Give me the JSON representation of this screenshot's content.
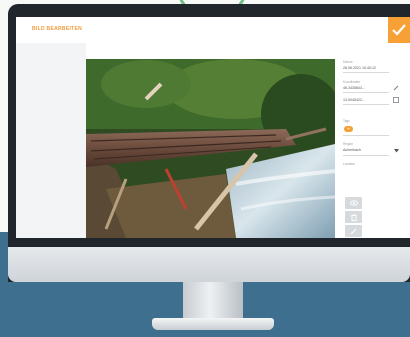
{
  "header": {
    "title": "BILD BEARBEITEN"
  },
  "sidebar": {
    "datum_label": "Datum",
    "datum_value": "28.06.2021 10:40:12",
    "koordinaten_label": "Koordinaten",
    "lat_value": "46.3435843...",
    "lon_value": "13.0045422...",
    "tags_label": "Tags",
    "tag_badge": "+",
    "region_label": "Region",
    "region_value": "Achenbach",
    "location_label": "Location"
  },
  "icons": {
    "confirm": "check-icon",
    "edit": "pencil-icon",
    "map": "map-icon",
    "dropdown": "caret-down-icon",
    "tools": [
      "eye-icon",
      "trash-icon",
      "pencil-icon"
    ]
  },
  "colors": {
    "accent": "#f6a035",
    "ring": "#74c08a",
    "desk": "#3f6f8f",
    "bezel": "#20262c"
  }
}
